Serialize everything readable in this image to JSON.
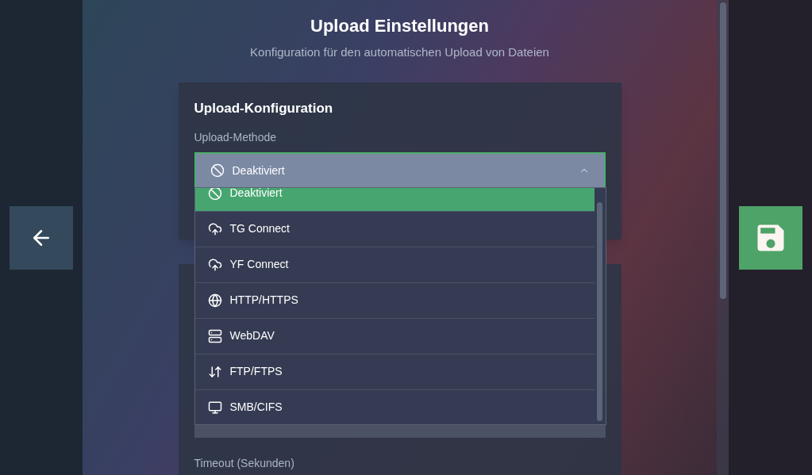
{
  "header": {
    "title": "Upload Einstellungen",
    "subtitle": "Konfiguration für den automatischen Upload von Dateien"
  },
  "card": {
    "heading": "Upload-Konfiguration",
    "method_field": {
      "label": "Upload-Methode",
      "value": "Deaktiviert",
      "expanded": true,
      "options": [
        {
          "label": "Deaktiviert",
          "selected": true
        },
        {
          "label": "TG Connect",
          "selected": false
        },
        {
          "label": "YF Connect",
          "selected": false
        },
        {
          "label": "HTTP/HTTPS",
          "selected": false
        },
        {
          "label": "WebDAV",
          "selected": false
        },
        {
          "label": "FTP/FTPS",
          "selected": false
        },
        {
          "label": "SMB/CIFS",
          "selected": false
        }
      ]
    }
  },
  "timeout_field": {
    "label": "Timeout (Sekunden)"
  }
}
